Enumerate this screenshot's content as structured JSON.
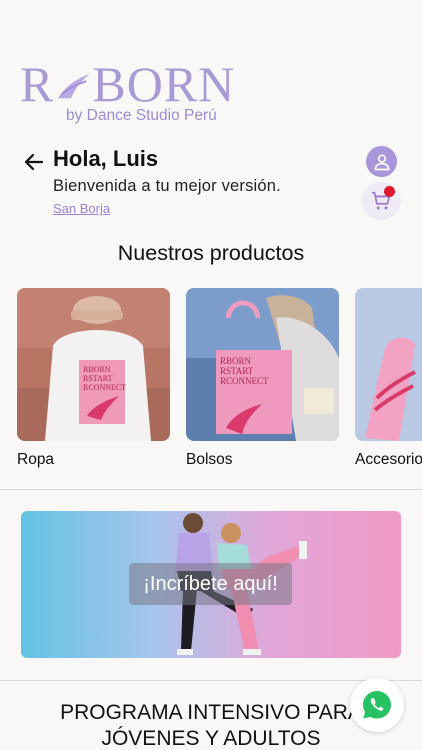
{
  "brand": {
    "logo_text": "RBORN",
    "logo_subtitle": "by Dance Studio Perú",
    "accent": "#a895dc"
  },
  "header": {
    "greeting": "Hola, Luis",
    "welcome": "Bienvenida a tu mejor versión.",
    "location": "San Borja",
    "cart_badge_color": "#e0182d"
  },
  "products": {
    "title": "Nuestros productos",
    "items": [
      {
        "label": "Ropa",
        "print_lines": [
          "RBORN",
          "RSTART",
          "RCONNECT"
        ]
      },
      {
        "label": "Bolsos",
        "print_lines": [
          "RBORN",
          "RSTART",
          "RCONNECT"
        ]
      },
      {
        "label": "Accesorios"
      }
    ]
  },
  "banner": {
    "cta": "¡Incríbete aquí!"
  },
  "program": {
    "title_line1": "PROGRAMA INTENSIVO PARA",
    "title_line2": "JÓVENES Y ADULTOS"
  },
  "icons": {
    "back": "arrow-left-icon",
    "profile": "user-icon",
    "cart": "cart-icon",
    "whatsapp": "whatsapp-icon"
  }
}
